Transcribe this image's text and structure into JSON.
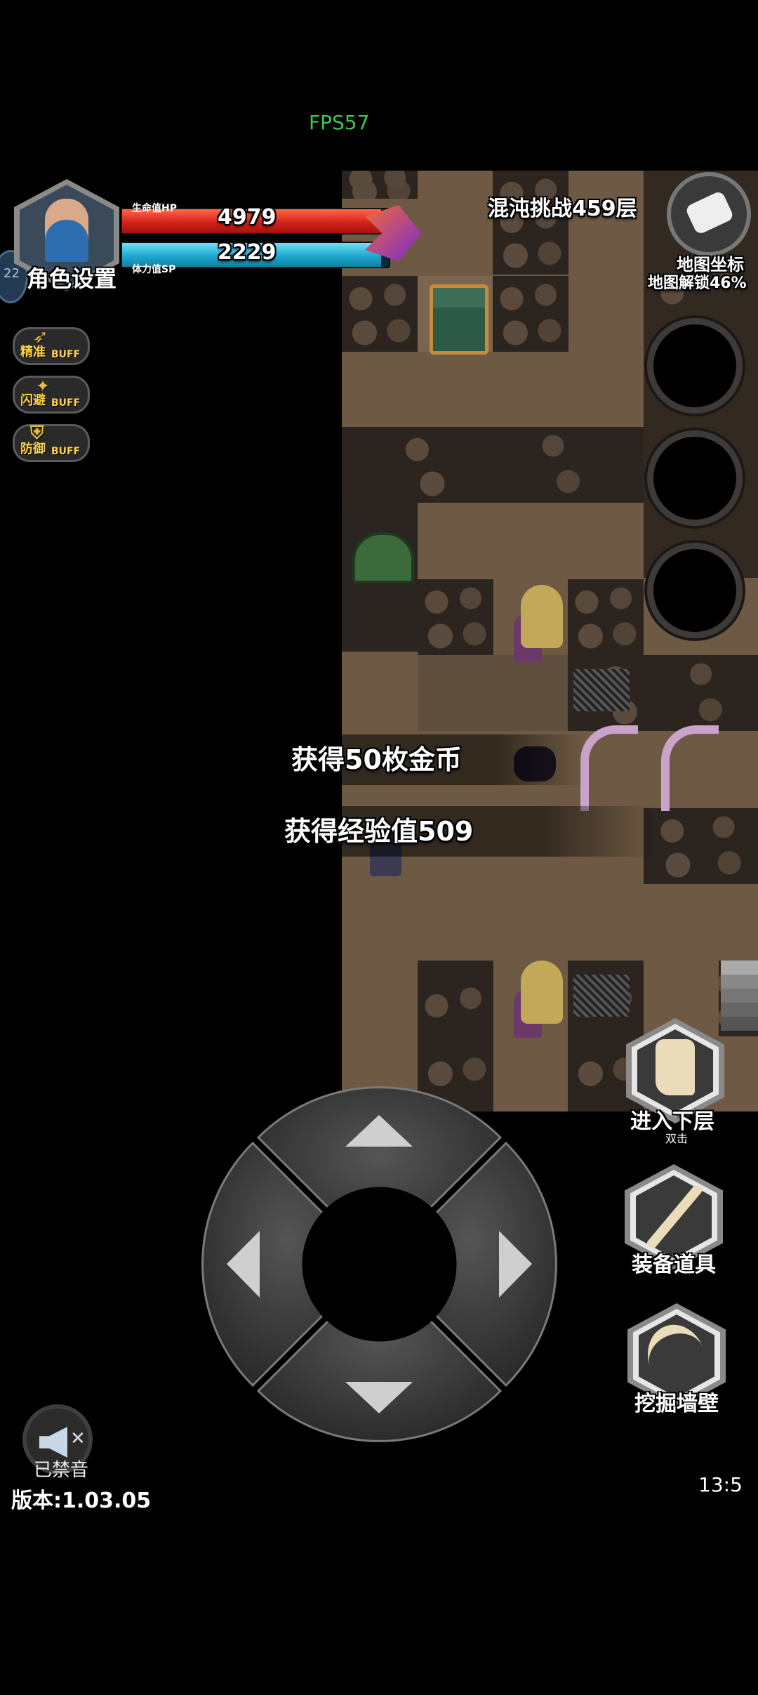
{
  "fps": "FPS57",
  "floor_title": "混沌挑战459层",
  "map_coord": {
    "label": "地图坐标",
    "unlock": "地图解锁46%"
  },
  "player": {
    "settings_label": "角色设置",
    "level_badge": "22",
    "hp": {
      "label": "生命值HP",
      "value": "4979",
      "fraction": 0.97
    },
    "sp": {
      "label": "体力值SP",
      "value": "2229",
      "fraction": 0.97
    }
  },
  "buffs": [
    {
      "label": "精准",
      "tag": "BUFF",
      "icon": "bow-icon"
    },
    {
      "label": "闪避",
      "tag": "BUFF",
      "icon": "fox-icon"
    },
    {
      "label": "防御",
      "tag": "BUFF",
      "icon": "shield-icon"
    }
  ],
  "messages": [
    "获得50枚金币",
    "获得经验值509"
  ],
  "actions": {
    "next_floor": {
      "label": "进入下层",
      "hint": "双击"
    },
    "equipment": {
      "label": "装备道具"
    },
    "dig": {
      "label": "挖掘墙壁"
    }
  },
  "sound": {
    "label": "已禁音"
  },
  "version": "版本:1.03.05",
  "clock": "13:5",
  "colors": {
    "fps": "#3cc74a",
    "hp": "#e5322a",
    "sp": "#29b6d8",
    "buff_text": "#ffd34a"
  }
}
